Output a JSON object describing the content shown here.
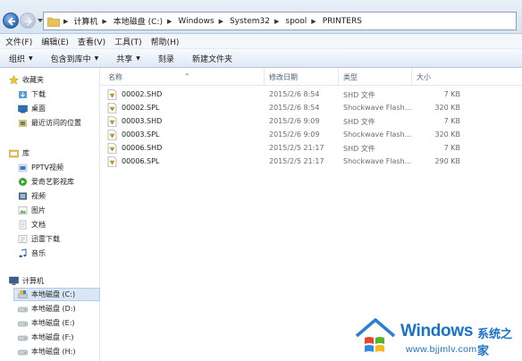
{
  "address": {
    "crumbs": [
      "计算机",
      "本地磁盘 (C:)",
      "Windows",
      "System32",
      "spool",
      "PRINTERS"
    ]
  },
  "menu": [
    "文件(F)",
    "编辑(E)",
    "查看(V)",
    "工具(T)",
    "帮助(H)"
  ],
  "toolbar": {
    "organize": "组织",
    "include": "包含到库中",
    "share": "共享",
    "burn": "刻录",
    "newfolder": "新建文件夹"
  },
  "nav": {
    "favorites": {
      "header": "收藏夹",
      "items": [
        "下载",
        "桌面",
        "最近访问的位置"
      ]
    },
    "library": {
      "header": "库",
      "items": [
        "PPTV视频",
        "爱奇艺影视库",
        "视频",
        "图片",
        "文档",
        "迅雷下载",
        "音乐"
      ]
    },
    "computer": {
      "header": "计算机",
      "items": [
        "本地磁盘 (C:)",
        "本地磁盘 (D:)",
        "本地磁盘 (E:)",
        "本地磁盘 (F:)",
        "本地磁盘 (H:)"
      ]
    }
  },
  "columns": {
    "name": "名称",
    "date": "修改日期",
    "type": "类型",
    "size": "大小"
  },
  "files": [
    {
      "name": "00002.SHD",
      "date": "2015/2/6 8:54",
      "type": "SHD 文件",
      "size": "7 KB"
    },
    {
      "name": "00002.SPL",
      "date": "2015/2/6 8:54",
      "type": "Shockwave Flash...",
      "size": "320 KB"
    },
    {
      "name": "00003.SHD",
      "date": "2015/2/6 9:09",
      "type": "SHD 文件",
      "size": "7 KB"
    },
    {
      "name": "00003.SPL",
      "date": "2015/2/6 9:09",
      "type": "Shockwave Flash...",
      "size": "320 KB"
    },
    {
      "name": "00006.SHD",
      "date": "2015/2/5 21:17",
      "type": "SHD 文件",
      "size": "7 KB"
    },
    {
      "name": "00006.SPL",
      "date": "2015/2/5 21:17",
      "type": "Shockwave Flash...",
      "size": "290 KB"
    }
  ],
  "watermark": {
    "brand": "Windows",
    "brand_cn": "系统之家",
    "url": "www.bjjmlv.com"
  },
  "colors": {
    "accent": "#1a73c7",
    "selection": "#d9e6f5"
  }
}
